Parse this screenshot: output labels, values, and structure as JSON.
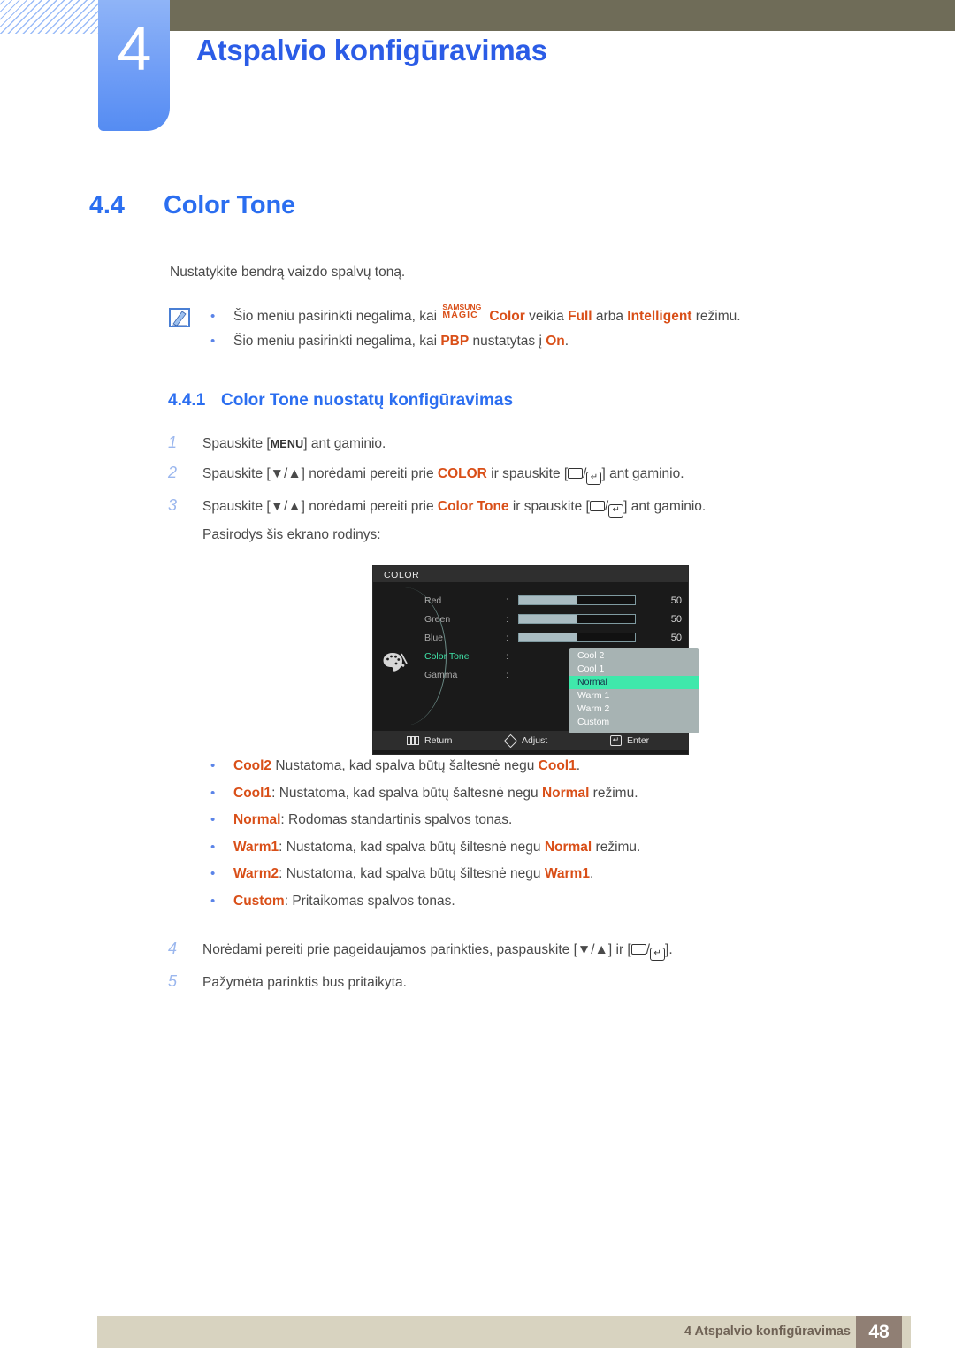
{
  "chapter": {
    "number": "4",
    "title": "Atspalvio konfigūravimas"
  },
  "section": {
    "number": "4.4",
    "title": "Color Tone",
    "intro": "Nustatykite bendrą vaizdo spalvų toną."
  },
  "notes": {
    "icon": "note-pencil-icon",
    "items": [
      {
        "pre": "Šio meniu pasirinkti negalima, kai ",
        "magic_top": "SAMSUNG",
        "magic_bottom": "MAGIC",
        "brand_suffix": "Color",
        "mid": " veikia ",
        "hl1": "Full",
        "mid2": " arba ",
        "hl2": "Intelligent",
        "post": " režimu."
      },
      {
        "pre": "Šio meniu pasirinkti negalima, kai ",
        "hl1": "PBP",
        "mid": " nustatytas į ",
        "hl2": "On",
        "post": "."
      }
    ]
  },
  "subsection": {
    "number": "4.4.1",
    "title": "Color Tone nuostatų konfigūravimas"
  },
  "steps": [
    {
      "num": "1",
      "t1": "Spauskite [",
      "key": "MENU",
      "t2": "] ant gaminio."
    },
    {
      "num": "2",
      "t1": "Spauskite [▼/▲] norėdami pereiti prie ",
      "hl": "COLOR",
      "t2": " ir spauskite [",
      "t3": "/",
      "t4": "] ant gaminio."
    },
    {
      "num": "3",
      "t1": "Spauskite [▼/▲] norėdami pereiti prie ",
      "hl": "Color Tone",
      "t2": " ir spauskite [",
      "t3": "/",
      "t4": "] ant gaminio.",
      "sub": "Pasirodys šis ekrano rodinys:"
    }
  ],
  "steps_after": [
    {
      "num": "4",
      "t1": "Norėdami pereiti prie pageidaujamos parinkties, paspauskite [▼/▲] ir [",
      "t2": "/",
      "t3": "]."
    },
    {
      "num": "5",
      "t1": "Pažymėta parinktis bus pritaikyta."
    }
  ],
  "osd": {
    "title": "COLOR",
    "icon": "palette-icon",
    "rows": [
      {
        "label": "Red",
        "colon": ":",
        "value": "50",
        "fill": 50,
        "type": "slider"
      },
      {
        "label": "Green",
        "colon": ":",
        "value": "50",
        "fill": 50,
        "type": "slider"
      },
      {
        "label": "Blue",
        "colon": ":",
        "value": "50",
        "fill": 50,
        "type": "slider"
      },
      {
        "label": "Color Tone",
        "colon": ":",
        "value": "",
        "type": "dropdown",
        "active": true
      },
      {
        "label": "Gamma",
        "colon": ":",
        "value": "",
        "type": "blank"
      }
    ],
    "dropdown": {
      "options": [
        "Cool 2",
        "Cool 1",
        "Normal",
        "Warm 1",
        "Warm 2",
        "Custom"
      ],
      "selected": "Normal"
    },
    "footer": {
      "return_icon": "menu-bars-icon",
      "return_label": "Return",
      "adjust_icon": "diamond-icon",
      "adjust_label": "Adjust",
      "enter_icon": "enter-arrow-icon",
      "enter_label": "Enter"
    },
    "colors": {
      "background": "#1a1a1a",
      "title_bar": "#2f2f2f",
      "highlight": "#3fe8ab",
      "active_label": "#3fe0a6",
      "slider_fill": "#a9bcc2",
      "dropdown_bg": "#a7b3b3"
    }
  },
  "options": [
    {
      "name": "Cool2",
      "sep": " ",
      "desc_pre": "Nustatoma, kad spalva būtų šaltesnė negu ",
      "ref": "Cool1",
      "desc_post": "."
    },
    {
      "name": "Cool1",
      "sep": ": ",
      "desc_pre": "Nustatoma, kad spalva būtų šaltesnė negu ",
      "ref": "Normal",
      "desc_post": " režimu."
    },
    {
      "name": "Normal",
      "sep": ": ",
      "desc_pre": "Rodomas standartinis spalvos tonas.",
      "ref": "",
      "desc_post": ""
    },
    {
      "name": "Warm1",
      "sep": ": ",
      "desc_pre": "Nustatoma, kad spalva būtų šiltesnė negu ",
      "ref": "Normal",
      "desc_post": " režimu."
    },
    {
      "name": "Warm2",
      "sep": ": ",
      "desc_pre": "Nustatoma, kad spalva būtų šiltesnė negu ",
      "ref": "Warm1",
      "desc_post": "."
    },
    {
      "name": "Custom",
      "sep": ": ",
      "desc_pre": "Pritaikomas spalvos tonas.",
      "ref": "",
      "desc_post": ""
    }
  ],
  "footer": {
    "text": "4 Atspalvio konfigūravimas",
    "page": "48"
  },
  "theme": {
    "accent_blue": "#2b6ef0",
    "orange": "#d94f18",
    "olive": "#6f6c58",
    "footer_bar": "#d8d3c0",
    "footer_page_box": "#907f74"
  }
}
